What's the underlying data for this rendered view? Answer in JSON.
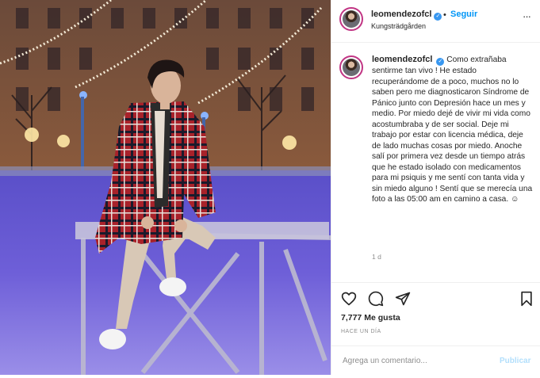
{
  "post": {
    "username": "leomendezofcl",
    "verified_glyph": "✓",
    "follow_label": "Seguir",
    "separator": "•",
    "location": "Kungsträdgården",
    "more_glyph": "···",
    "caption": "Como extrañaba sentirme tan vivo ! He estado recuperándome de a poco, muchos no lo saben pero me diagnosticaron Síndrome de Pánico junto con Depresión hace un mes y medio. Por miedo dejé de vivir mi vida como acostumbraba y de ser social. Deje mi trabajo por estar con licencia médica, deje de lado muchas cosas por miedo. Anoche salí por primera vez desde un tiempo atrás que he estado isolado con medicamentos para mi psiquis y me sentí con tanta vida y sin miedo alguno ! Sentí que se merecía una foto a las 05:00 am en camino a casa. ☺",
    "time_ago": "1 d",
    "likes": "7,777 Me gusta",
    "date_label": "HACE UN DÍA",
    "comment_placeholder": "Agrega un comentario...",
    "publish_label": "Publicar"
  },
  "icons": {
    "like": "heart-icon",
    "comment": "comment-icon",
    "share": "share-icon",
    "save": "bookmark-icon",
    "verified": "verified-badge-icon",
    "more": "more-options-icon"
  },
  "colors": {
    "link_blue": "#0095f6",
    "verified_blue": "#3897f0",
    "muted": "#8e8e8e",
    "border": "#efefef",
    "publish_disabled": "#b2dffc"
  }
}
